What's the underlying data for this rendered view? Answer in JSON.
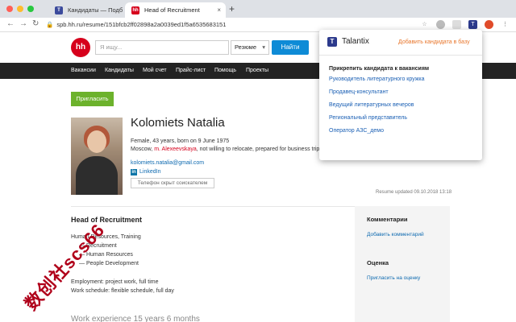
{
  "browser": {
    "tabs": [
      {
        "title": "Кандидаты — Подбор персо",
        "favicon": "T",
        "color": "#3b4a9c",
        "active": false
      },
      {
        "title": "Head of Recruitment",
        "favicon": "hh",
        "color": "#d6001c",
        "active": true
      }
    ],
    "url": "spb.hh.ru/resume/151bfcb2ff02898a2a0039ed1f5a6535683151",
    "new_tab": "+",
    "close_glyph": "×",
    "nav": {
      "back": "←",
      "forward": "→",
      "reload": "↻"
    },
    "ext_icons": [
      "star-icon",
      "extension-icon",
      "talantix-extension-icon",
      "settings-icon",
      "profile-icon",
      "menu-icon"
    ]
  },
  "hh": {
    "logo": "hh",
    "search_placeholder": "Я ищу...",
    "search_type": "Резюме",
    "search_button": "Найти",
    "nav": [
      "Вакансии",
      "Кандидаты",
      "Мой счет",
      "Прайс-лист",
      "Помощь",
      "Проекты"
    ]
  },
  "candidate": {
    "invite_button": "Пригласить",
    "name": "Kolomiets Natalia",
    "info_line1": "Female, 43 years, born on 9 June 1975",
    "info_line2_prefix": "Moscow, ",
    "metro": "m. Alexeevskaya",
    "info_line2_suffix": ", not willing to relocate, prepared for business trips",
    "email": "kolomiets.natalia@gmail.com",
    "linkedin": "LinkedIn",
    "phone_hidden": "Телефон скрыт соискателем",
    "updated": "Resume updated 09.10.2018 13:18"
  },
  "resume": {
    "position": "Head of Recruitment",
    "specializations": [
      "Human Resources, Training",
      "— Recruitment",
      "— Human Resources",
      "— People Development"
    ],
    "employment": "Employment: project work, full time",
    "schedule": "Work schedule: flexible schedule, full day",
    "experience": "Work experience 15 years 6 months"
  },
  "sidebar": {
    "comments_title": "Комментарии",
    "add_comment": "Добавить комментарий",
    "rating_title": "Оценка",
    "invite_rating": "Пригласить на оценку"
  },
  "popup": {
    "brand": "Talantix",
    "add_to_base": "Добавить кандидата в базу",
    "attach_title": "Прикрепить кандидата к вакансиям",
    "vacancies": [
      "Руководитель литературного кружка",
      "Продавец-консультант",
      "Ведущий литературных вечеров",
      "Региональный представитель",
      "Оператор АЗС_демо"
    ]
  },
  "watermark": "数创社scs66"
}
